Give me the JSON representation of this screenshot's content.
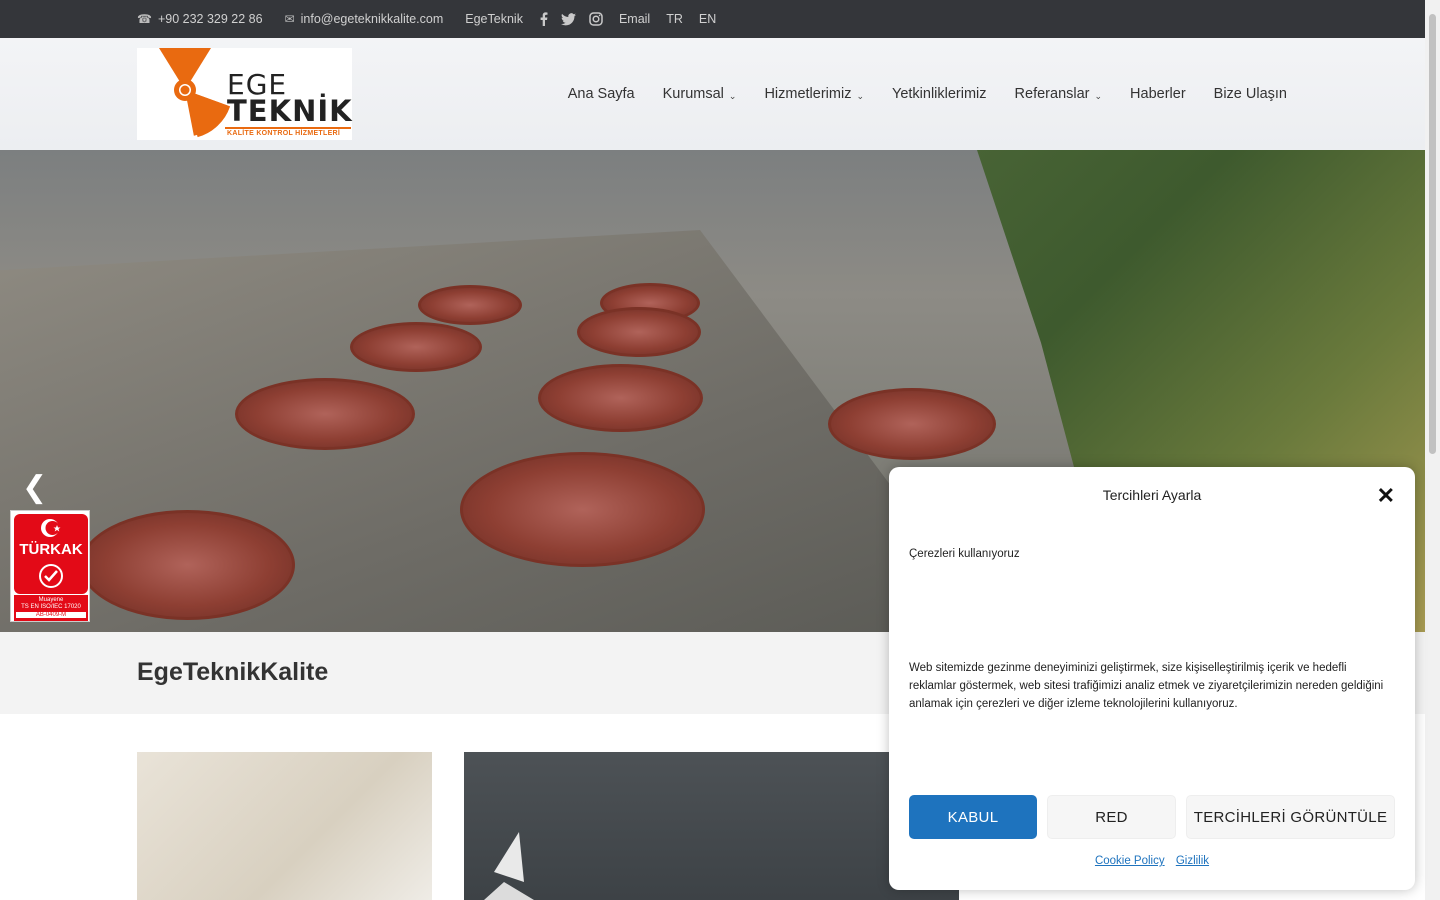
{
  "topbar": {
    "phone": "+90 232 329 22 86",
    "email": "info@egeteknikkalite.com",
    "brand_link": "EgeTeknik",
    "email_link": "Email",
    "lang_tr": "TR",
    "lang_en": "EN",
    "social_icons": [
      "facebook-icon",
      "twitter-icon",
      "instagram-icon"
    ]
  },
  "logo": {
    "line1": "EGE",
    "line2": "TEKNİK",
    "tagline": "KALİTE KONTROL HİZMETLERİ",
    "accent_color": "#e96a10"
  },
  "nav": {
    "items": [
      {
        "label": "Ana Sayfa",
        "dropdown": false
      },
      {
        "label": "Kurumsal",
        "dropdown": true
      },
      {
        "label": "Hizmetlerimiz",
        "dropdown": true
      },
      {
        "label": "Yetkinliklerimiz",
        "dropdown": false
      },
      {
        "label": "Referanslar",
        "dropdown": true
      },
      {
        "label": "Haberler",
        "dropdown": false
      },
      {
        "label": "Bize Ulaşın",
        "dropdown": false
      }
    ]
  },
  "hero": {
    "prev_icon": "chevron-left-icon",
    "next_icon": "chevron-right-icon"
  },
  "badge": {
    "name": "TÜRKAK",
    "line1": "Muayene",
    "line2": "TS EN ISO/IEC 17020",
    "code": "AB-0409-M"
  },
  "page": {
    "title": "EgeTeknikKalite"
  },
  "cookie": {
    "title": "Tercihleri Ayarla",
    "subtitle": "Çerezleri kullanıyoruz",
    "body": "Web sitemizde gezinme deneyiminizi geliştirmek, size kişiselleştirilmiş içerik ve hedefli reklamlar göstermek, web sitesi trafiğimizi analiz etmek ve ziyaretçilerimizin nereden geldiğini anlamak için çerezleri ve diğer izleme teknolojilerini kullanıyoruz.",
    "accept": "KABUL",
    "deny": "RED",
    "preferences": "TERCİHLERİ GÖRÜNTÜLE",
    "cookie_policy": "Cookie Policy",
    "privacy": "Gizlilik",
    "accent_color": "#1e73be"
  }
}
